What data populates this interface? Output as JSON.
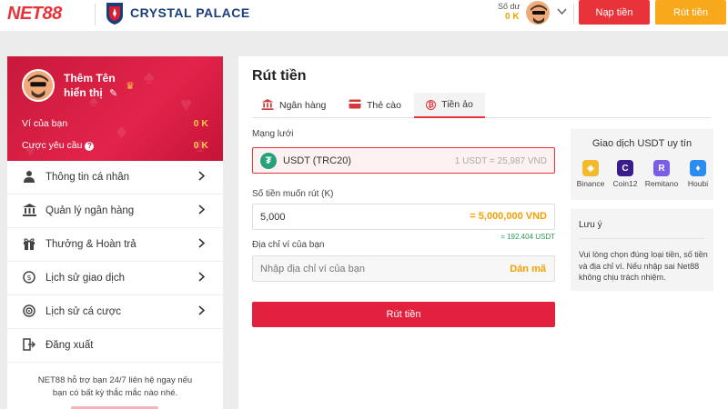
{
  "header": {
    "logo": "NET88",
    "partner": "CRYSTAL PALACE",
    "balance_label": "Số dư",
    "balance_value": "0 K",
    "deposit_label": "Nạp tiền",
    "withdraw_label": "Rút tiền"
  },
  "sidebar": {
    "name_line1": "Thêm Tên",
    "name_line2": "hiển thị",
    "wallet_label": "Ví của bạn",
    "wallet_value": "0 K",
    "wager_label": "Cược yêu cầu",
    "wager_value": "0 K",
    "items": [
      {
        "label": "Thông tin cá nhân",
        "icon": "user-icon"
      },
      {
        "label": "Quản lý ngân hàng",
        "icon": "bank-icon"
      },
      {
        "label": "Thưởng & Hoàn trả",
        "icon": "gift-icon"
      },
      {
        "label": "Lịch sử giao dịch",
        "icon": "history-icon"
      },
      {
        "label": "Lịch sử cá cược",
        "icon": "bet-history-icon"
      },
      {
        "label": "Đăng xuất",
        "icon": "logout-icon"
      }
    ],
    "support_text1": "NET88 hỗ trợ bạn 24/7 liên hệ ngay nếu",
    "support_text2": "bạn có bất kỳ thắc mắc nào nhé."
  },
  "main": {
    "title": "Rút tiền",
    "tabs": [
      {
        "label": "Ngân hàng"
      },
      {
        "label": "Thẻ cào"
      },
      {
        "label": "Tiền ảo",
        "active": true
      }
    ],
    "network_label": "Mạng lưới",
    "network_value": "USDT (TRC20)",
    "network_rate": "1 USDT = 25,987 VND",
    "amount_label": "Số tiền muốn rút (K)",
    "amount_value": "5,000",
    "amount_converted": "= 5,000,000 VND",
    "amount_usdt": "= 192.404 USDT",
    "wallet_label": "Địa chỉ ví của bạn",
    "wallet_placeholder": "Nhập địa chỉ ví của bạn",
    "paste_label": "Dán mã",
    "submit_label": "Rút tiền"
  },
  "trust": {
    "title": "Giao dịch USDT uy tín",
    "exchanges": [
      {
        "name": "Binance",
        "color": "#f3ba2f"
      },
      {
        "name": "Coin12",
        "color": "#3b1c8c"
      },
      {
        "name": "Remitano",
        "color": "#7c5ee6"
      },
      {
        "name": "Houbi",
        "color": "#2d8cf0"
      }
    ]
  },
  "note": {
    "title": "Lưu ý",
    "text": "Vui lòng chọn đúng loại tiền, số tiền và địa chỉ ví. Nếu nhập sai Net88 không chịu trách nhiệm."
  },
  "colors": {
    "brand_red": "#e8333a",
    "accent_orange": "#f7a81b",
    "positive_green": "#2d9b53"
  }
}
